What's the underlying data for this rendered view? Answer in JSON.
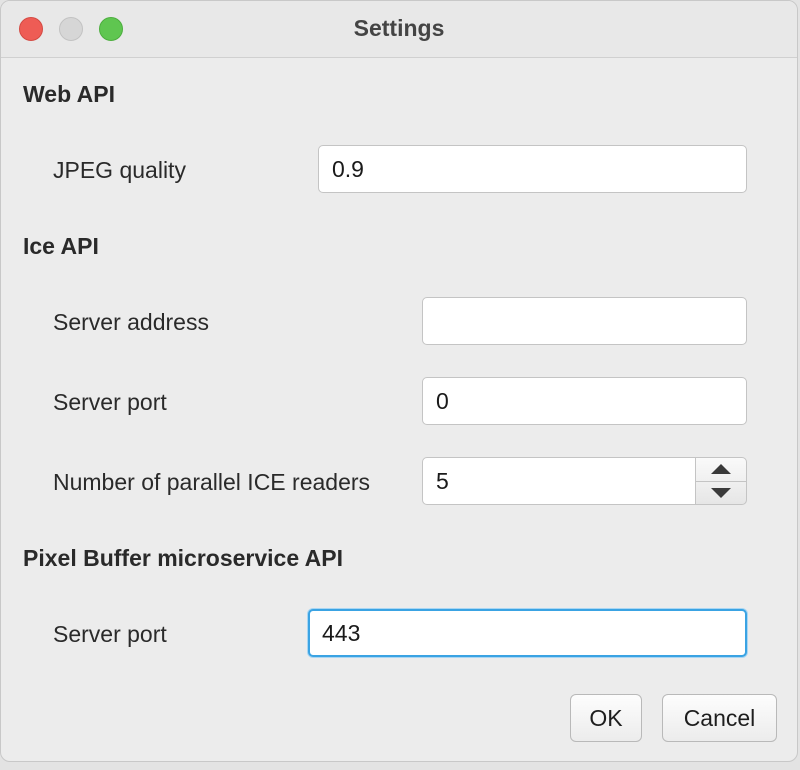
{
  "window": {
    "title": "Settings"
  },
  "sections": {
    "web_api": {
      "heading": "Web API",
      "jpeg_quality_label": "JPEG quality",
      "jpeg_quality_value": "0.9"
    },
    "ice_api": {
      "heading": "Ice API",
      "server_address_label": "Server address",
      "server_address_value": "",
      "server_port_label": "Server port",
      "server_port_value": "0",
      "parallel_readers_label": "Number of parallel ICE readers",
      "parallel_readers_value": "5"
    },
    "pixel_buffer_api": {
      "heading": "Pixel Buffer microservice API",
      "server_port_label": "Server port",
      "server_port_value": "443"
    }
  },
  "buttons": {
    "ok_label": "OK",
    "cancel_label": "Cancel"
  },
  "icons": {
    "spinner_up": "chevron-up-icon",
    "spinner_down": "chevron-down-icon"
  },
  "colors": {
    "close": "#ee5c55",
    "minimize": "#d6d6d6",
    "zoom": "#5fc650",
    "focus_ring": "#3aa3e3"
  }
}
